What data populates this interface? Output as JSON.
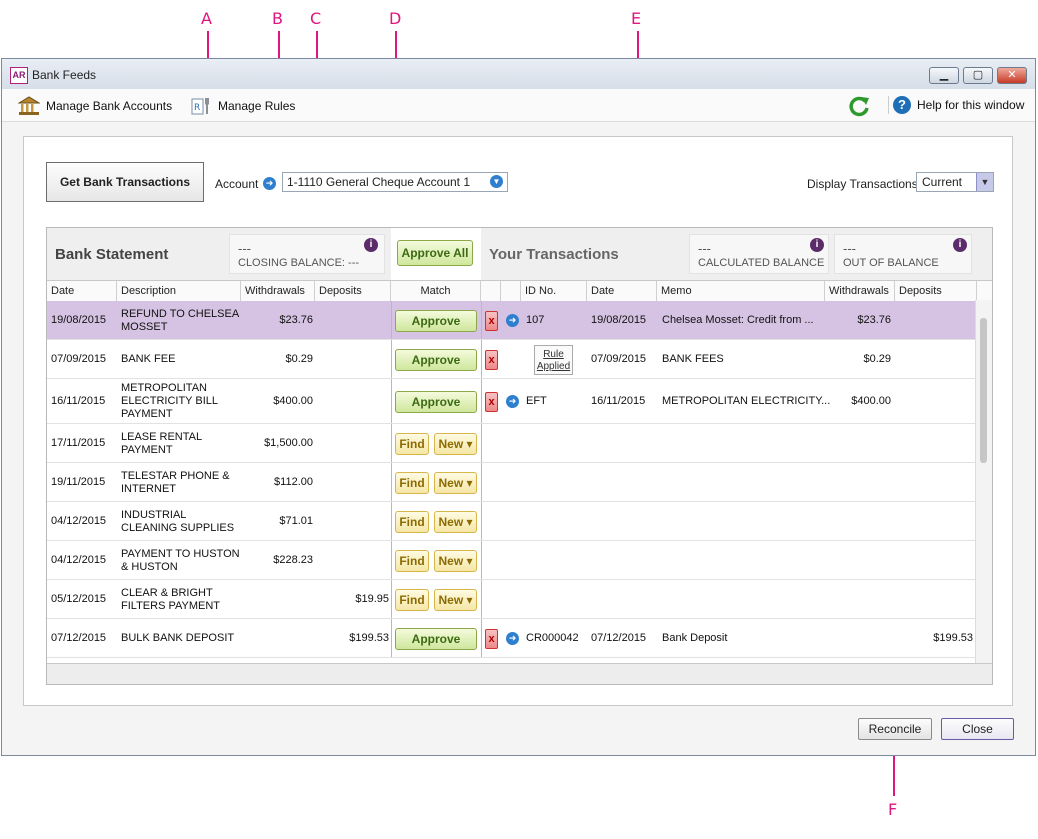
{
  "callouts": [
    "A",
    "B",
    "C",
    "D",
    "E",
    "F"
  ],
  "window": {
    "title": "Bank Feeds",
    "logo_text": "AR",
    "min_label": "▁",
    "max_label": "▢",
    "close_label": "✕"
  },
  "toolbar": {
    "manage_accounts_label": "Manage Bank Accounts",
    "manage_rules_label": "Manage Rules",
    "help_label": "Help for this window",
    "help_icon_text": "?"
  },
  "controls": {
    "get_bank_transactions_label": "Get Bank Transactions",
    "account_label": "Account",
    "account_value": "1-1110 General Cheque Account 1",
    "display_label": "Display Transactions:",
    "display_value": "Current"
  },
  "bank_statement": {
    "title": "Bank Statement",
    "closing_value": "---",
    "closing_label": "CLOSING BALANCE: ---"
  },
  "approve_all_label": "Approve All",
  "your_transactions": {
    "title": "Your Transactions",
    "calc_value": "---",
    "calc_label": "CALCULATED BALANCE",
    "oob_value": "---",
    "oob_label": "OUT OF BALANCE"
  },
  "columns": {
    "date": "Date",
    "description": "Description",
    "withdrawals": "Withdrawals",
    "deposits": "Deposits",
    "match": "Match",
    "id_no": "ID No.",
    "date2": "Date",
    "memo": "Memo",
    "withdrawals2": "Withdrawals",
    "deposits2": "Deposits"
  },
  "labels": {
    "approve": "Approve",
    "find": "Find",
    "new": "New ▾",
    "x": "x",
    "rule_applied": "Rule Applied",
    "info": "i"
  },
  "rows": [
    {
      "date": "19/08/2015",
      "desc": "REFUND TO CHELSEA MOSSET",
      "wd": "$23.76",
      "dep": "",
      "action": "approve",
      "selected": true,
      "x": true,
      "arrow": true,
      "id": "107",
      "tdate": "19/08/2015",
      "memo": "Chelsea Mosset:  Credit from ...",
      "twd": "$23.76",
      "tdep": ""
    },
    {
      "date": "07/09/2015",
      "desc": "BANK FEE",
      "wd": "$0.29",
      "dep": "",
      "action": "approve",
      "selected": false,
      "x": true,
      "arrow": false,
      "rule": true,
      "id": "",
      "tdate": "07/09/2015",
      "memo": "BANK FEES",
      "twd": "$0.29",
      "tdep": ""
    },
    {
      "date": "16/11/2015",
      "desc": "METROPOLITAN ELECTRICITY BILL PAYMENT",
      "wd": "$400.00",
      "dep": "",
      "action": "approve",
      "selected": false,
      "x": true,
      "arrow": true,
      "id": "EFT",
      "tdate": "16/11/2015",
      "memo": "METROPOLITAN ELECTRICITY...",
      "twd": "$400.00",
      "tdep": ""
    },
    {
      "date": "17/11/2015",
      "desc": "LEASE RENTAL PAYMENT",
      "wd": "$1,500.00",
      "dep": "",
      "action": "find"
    },
    {
      "date": "19/11/2015",
      "desc": "TELESTAR PHONE & INTERNET",
      "wd": "$112.00",
      "dep": "",
      "action": "find"
    },
    {
      "date": "04/12/2015",
      "desc": "INDUSTRIAL CLEANING SUPPLIES",
      "wd": "$71.01",
      "dep": "",
      "action": "find"
    },
    {
      "date": "04/12/2015",
      "desc": "PAYMENT TO HUSTON & HUSTON",
      "wd": "$228.23",
      "dep": "",
      "action": "find"
    },
    {
      "date": "05/12/2015",
      "desc": "CLEAR & BRIGHT FILTERS PAYMENT",
      "wd": "",
      "dep": "$19.95",
      "action": "find"
    },
    {
      "date": "07/12/2015",
      "desc": "BULK BANK DEPOSIT",
      "wd": "",
      "dep": "$199.53",
      "action": "approve",
      "selected": false,
      "x": true,
      "arrow": true,
      "id": "CR000042",
      "tdate": "07/12/2015",
      "memo": "Bank Deposit",
      "twd": "",
      "tdep": "$199.53"
    }
  ],
  "footer": {
    "reconcile_label": "Reconcile",
    "close_label": "Close"
  },
  "colors": {
    "accent": "#e0157f",
    "selected_row": "#d6c3e3",
    "approve": "#cfe79d",
    "find": "#f5e6a6"
  }
}
